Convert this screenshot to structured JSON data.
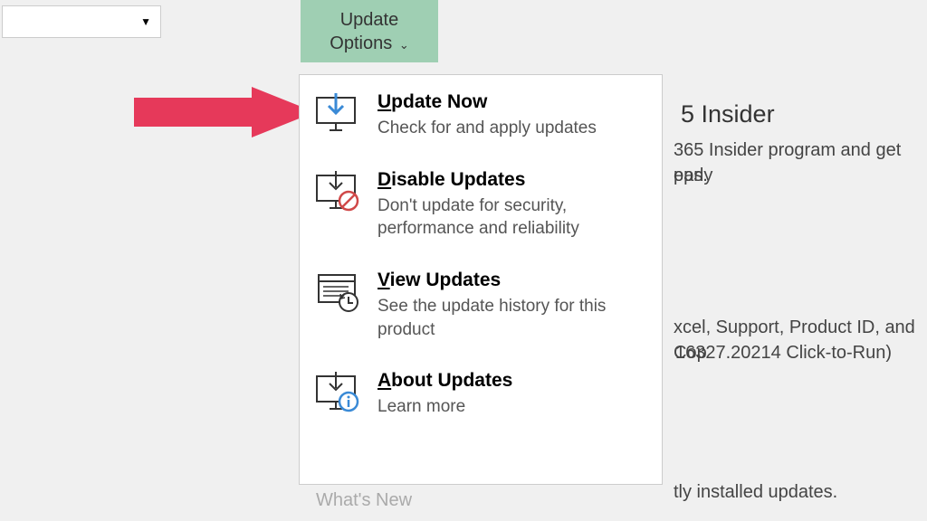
{
  "update_options_button": "Update\nOptions",
  "menu": {
    "items": [
      {
        "u": "U",
        "rest": "pdate Now",
        "desc": "Check for and apply updates"
      },
      {
        "u": "D",
        "rest": "isable Updates",
        "desc": "Don't update for security, performance and reliability"
      },
      {
        "u": "V",
        "rest": "iew Updates",
        "desc": "See the update history for this product"
      },
      {
        "u": "A",
        "rest": "bout Updates",
        "desc": "Learn more"
      }
    ]
  },
  "whats_new": "What's New",
  "bg": {
    "insider_title": "5 Insider",
    "insider_line1": "365 Insider program and get early",
    "insider_line2": "pps.",
    "line3": "xcel, Support, Product ID, and Cop",
    "line4": "16327.20214 Click-to-Run)",
    "line5": "tly installed updates."
  }
}
